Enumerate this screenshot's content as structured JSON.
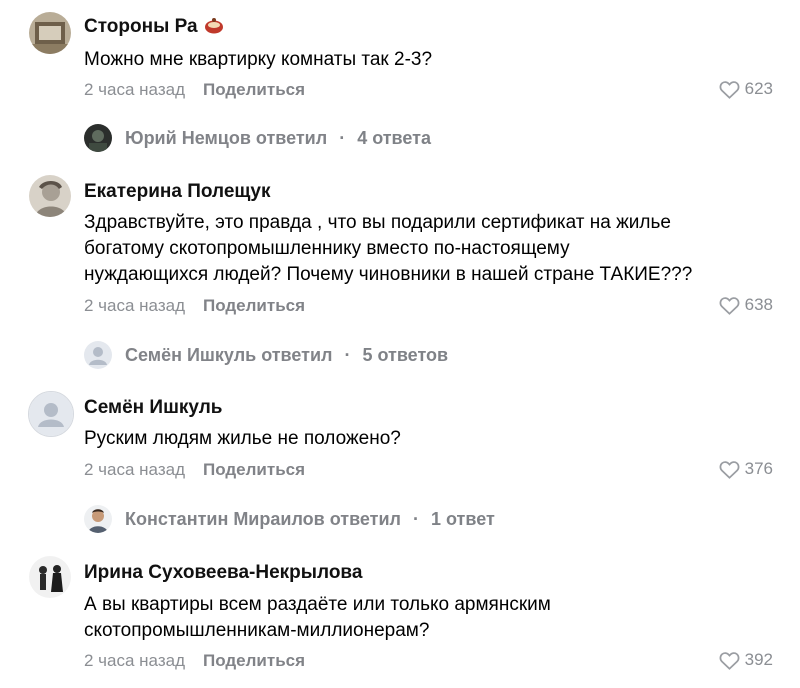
{
  "comments": [
    {
      "author": "Стороны Ра",
      "text": "Можно мне квартирку комнаты так 2-3?",
      "time": "2 часа назад",
      "share": "Поделиться",
      "likes": "623",
      "reply": {
        "name": "Юрий Немцов ответил",
        "count": "4 ответа"
      }
    },
    {
      "author": "Екатерина Полещук",
      "text": "Здравствуйте, это правда , что вы подарили сертификат на жилье\nбогатому скотопромышленнику вместо по-настоящему\nнуждающихся людей? Почему чиновники в нашей стране ТАКИЕ???",
      "time": "2 часа назад",
      "share": "Поделиться",
      "likes": "638",
      "reply": {
        "name": "Семён Ишкуль ответил",
        "count": "5 ответов"
      }
    },
    {
      "author": "Семён Ишкуль",
      "text": "Руским людям жилье не положено?",
      "time": "2 часа назад",
      "share": "Поделиться",
      "likes": "376",
      "reply": {
        "name": "Константин Мираилов ответил",
        "count": "1 ответ"
      }
    },
    {
      "author": "Ирина Суховеева-Некрылова",
      "text": "А вы квартиры всем раздаёте или только армянским\nскотопромышленникам-миллионерам?",
      "time": "2 часа назад",
      "share": "Поделиться",
      "likes": "392"
    }
  ],
  "colors": {
    "meta": "#8b8e93",
    "heart": "#9a9da2",
    "placeholder_avatar": "#e4e8ee"
  },
  "icons": {
    "like": "heart-icon",
    "author_badge": "emoji-icon"
  }
}
